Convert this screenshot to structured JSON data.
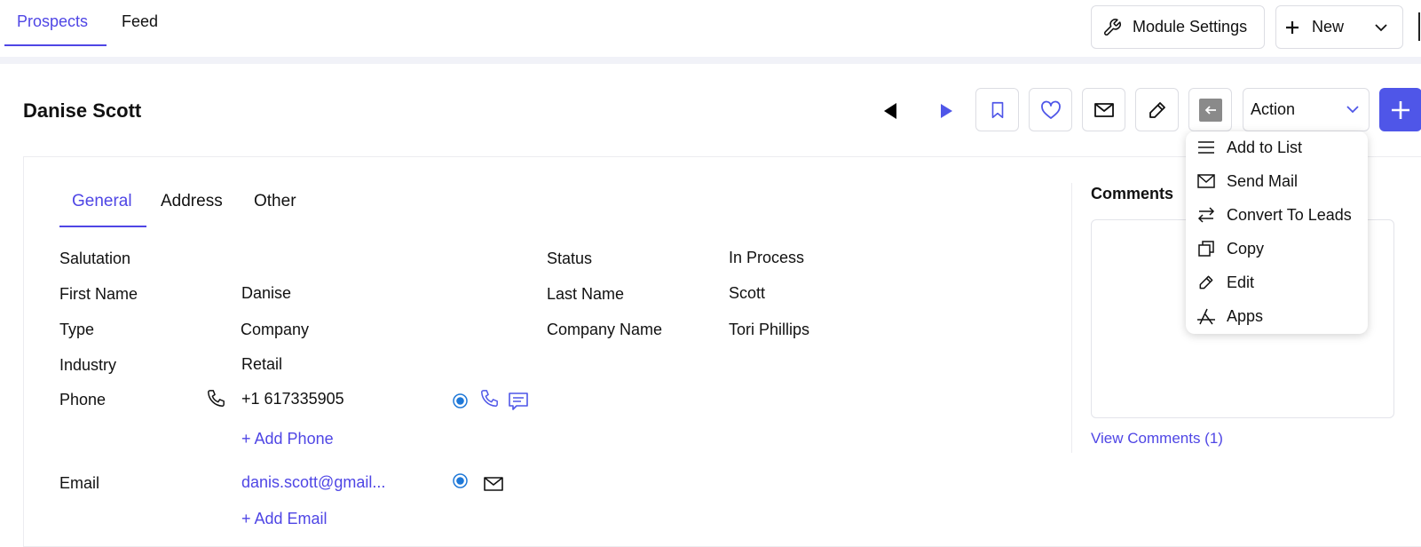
{
  "top_tabs": [
    {
      "label": "Prospects",
      "active": true
    },
    {
      "label": "Feed",
      "active": false
    }
  ],
  "toolbar": {
    "module_settings_label": "Module Settings",
    "new_label": "New"
  },
  "record": {
    "title": "Danise Scott",
    "action_label": "Action"
  },
  "sub_tabs": [
    {
      "label": "General",
      "active": true
    },
    {
      "label": "Address",
      "active": false
    },
    {
      "label": "Other",
      "active": false
    }
  ],
  "fields": {
    "salutation": {
      "label": "Salutation",
      "value": ""
    },
    "first_name": {
      "label": "First Name",
      "value": "Danise"
    },
    "type": {
      "label": "Type",
      "value": "Company"
    },
    "industry": {
      "label": "Industry",
      "value": "Retail"
    },
    "phone": {
      "label": "Phone",
      "value": "+1 617335905",
      "add_label": "+ Add Phone"
    },
    "email": {
      "label": "Email",
      "value": "danis.scott@gmail...",
      "add_label": "+ Add Email"
    },
    "status": {
      "label": "Status",
      "value": "In Process"
    },
    "last_name": {
      "label": "Last Name",
      "value": "Scott"
    },
    "company_name": {
      "label": "Company Name",
      "value": "Tori Phillips"
    }
  },
  "comments": {
    "title": "Comments",
    "view_link": "View Comments (1)"
  },
  "action_menu": [
    {
      "label": "Add to List",
      "icon": "list-icon"
    },
    {
      "label": "Send Mail",
      "icon": "mail-icon"
    },
    {
      "label": "Convert To Leads",
      "icon": "convert-icon"
    },
    {
      "label": "Copy",
      "icon": "copy-icon"
    },
    {
      "label": "Edit",
      "icon": "pencil-icon"
    },
    {
      "label": "Apps",
      "icon": "apps-icon"
    }
  ],
  "colors": {
    "accent": "#4f46e5",
    "primary_button": "#4f56e8",
    "radio_blue": "#1e78d8"
  }
}
